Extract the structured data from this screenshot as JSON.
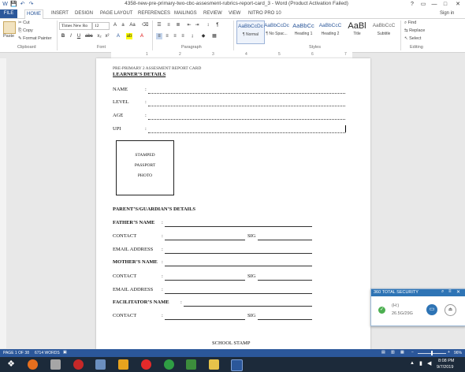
{
  "window": {
    "title": "4358-new-pre-primary-two-cbc-assesment-rubrics-report-card_3 - Word (Product Activation Failed)",
    "controls": [
      "?",
      "▭",
      "—",
      "□",
      "✕"
    ]
  },
  "quick_access": [
    "W",
    "💾",
    "↶",
    "↷"
  ],
  "tabs": [
    "FILE",
    "HOME",
    "INSERT",
    "DESIGN",
    "PAGE LAYOUT",
    "REFERENCES",
    "MAILINGS",
    "REVIEW",
    "VIEW",
    "NITRO PRO 10"
  ],
  "sign_in": "Sign in",
  "ribbon": {
    "clipboard": {
      "paste": "Paste",
      "cut": "Cut",
      "copy": "Copy",
      "format_painter": "Format Painter",
      "label": "Clipboard"
    },
    "font": {
      "name": "Times New Ro",
      "size": "12",
      "label": "Font"
    },
    "paragraph": {
      "label": "Paragraph"
    },
    "styles": {
      "label": "Styles",
      "items": [
        {
          "preview": "AaBbCcDc",
          "name": "¶ Normal"
        },
        {
          "preview": "AaBbCcDc",
          "name": "¶ No Spac..."
        },
        {
          "preview": "AaBbCc",
          "name": "Heading 1"
        },
        {
          "preview": "AaBbCcC",
          "name": "Heading 2"
        },
        {
          "preview": "AaBl",
          "name": "Title"
        },
        {
          "preview": "AaBbCcC",
          "name": "Subtitle"
        }
      ]
    },
    "editing": {
      "find": "Find",
      "replace": "Replace",
      "select": "Select",
      "label": "Editing"
    }
  },
  "ruler": [
    "1",
    "2",
    "3",
    "4",
    "5",
    "6",
    "7"
  ],
  "document": {
    "header_small": "PRE-PRIMARY 2 ASSESMENT REPORT CARD",
    "learner_heading": "LEARNER’S DETAILS",
    "learner_fields": [
      "NAME",
      "LEVEL",
      "AGE",
      "UPI"
    ],
    "colon": ":",
    "photo_lines": [
      "STAMPED",
      "PASSPORT",
      "PHOTO"
    ],
    "guardian_heading": "PARENT’S/GUARDIAN’S DETAILS",
    "father_name": "FATHER’S NAME",
    "mother_name": "MOTHER’S NAME",
    "facilitator_name": "FACILITATOR’S NAME",
    "contact": "CONTACT",
    "email": "EMAIL ADDRESS",
    "sig": "SIG",
    "school_stamp": "SCHOOL STAMP"
  },
  "status": {
    "page": "PAGE 1 OF 38",
    "words": "6714 WORDS",
    "zoom": "96%"
  },
  "taskbar": {
    "time": "8:08 PM",
    "date": "9/7/2019"
  },
  "security_popup": {
    "title": "360 TOTAL SECURITY",
    "drive": "(H:)",
    "size": "26.5G/29G"
  }
}
